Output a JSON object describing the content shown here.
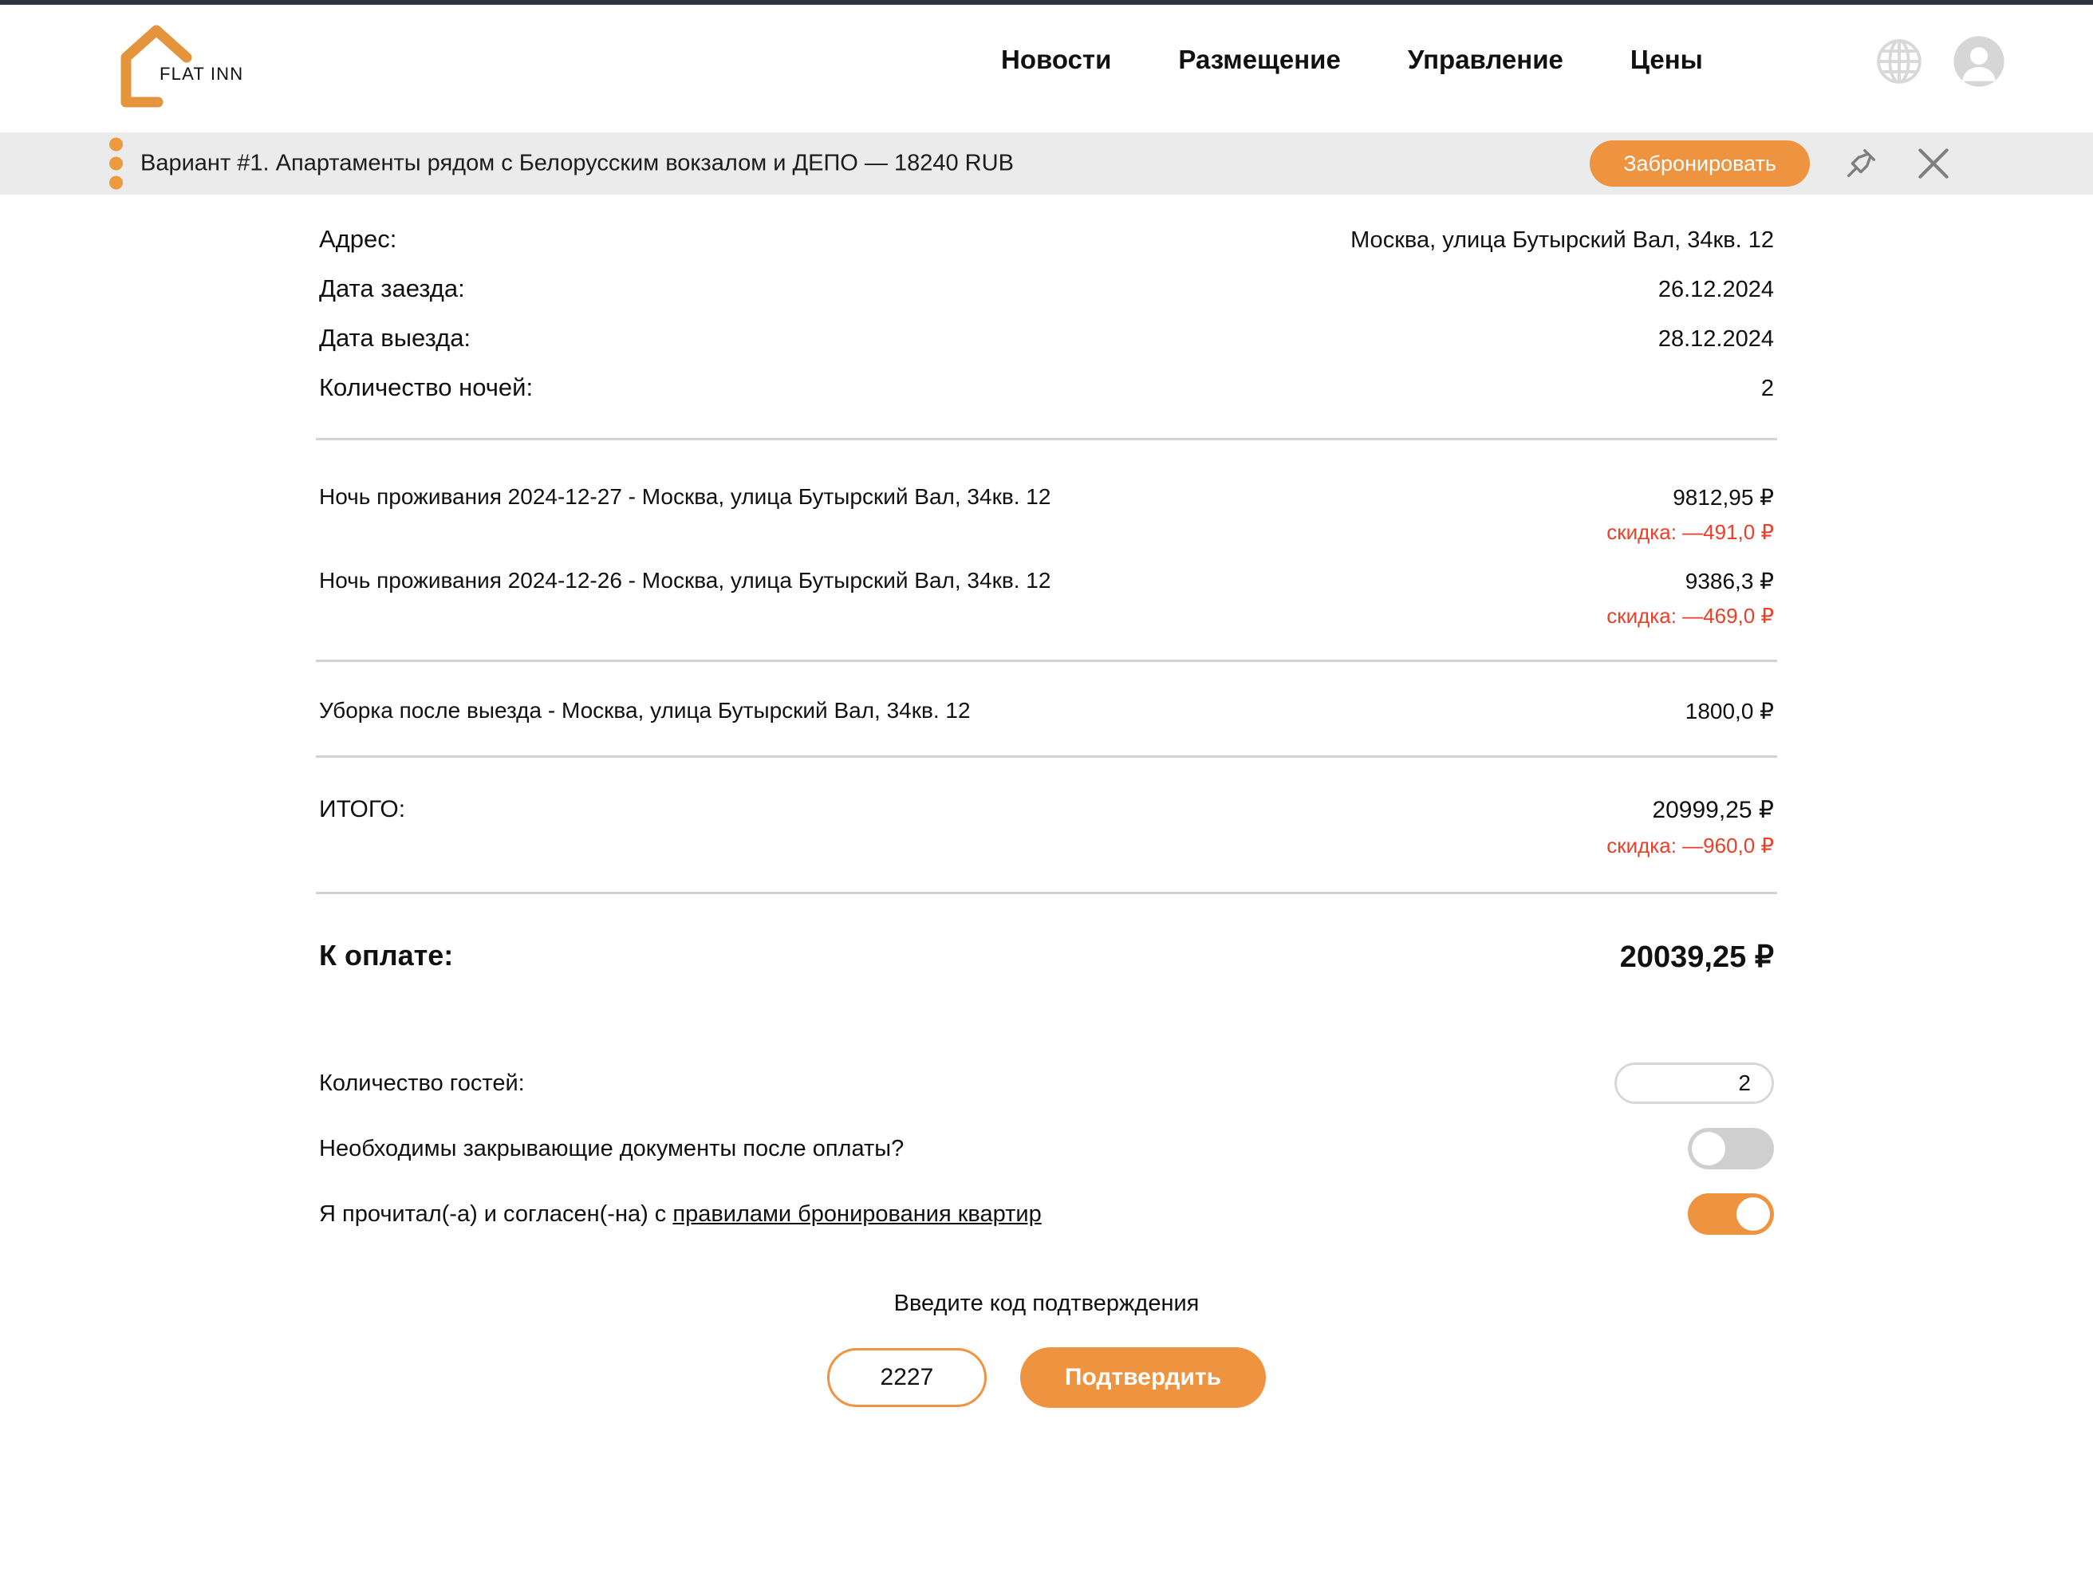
{
  "header": {
    "logo_text": "FLAT INN",
    "nav": [
      {
        "label": "Новости"
      },
      {
        "label": "Размещение"
      },
      {
        "label": "Управление"
      },
      {
        "label": "Цены"
      }
    ],
    "globe_icon": "globe-icon",
    "avatar_icon": "avatar-icon"
  },
  "banner": {
    "text": "Вариант #1. Апартаменты рядом с Белорусским вокзалом и ДЕПО — 18240 RUB",
    "book_button": "Забронировать",
    "pin_icon": "pin-icon",
    "close_icon": "close-icon"
  },
  "details": {
    "address_label": "Адрес:",
    "address_value": "Москва, улица Бутырский Вал, 34кв. 12",
    "checkin_label": "Дата заезда:",
    "checkin_value": "26.12.2024",
    "checkout_label": "Дата выезда:",
    "checkout_value": "28.12.2024",
    "nights_label": "Количество ночей:",
    "nights_value": "2"
  },
  "line_items": [
    {
      "description": "Ночь проживания 2024-12-27 - Москва, улица Бутырский Вал, 34кв. 12",
      "price": "9812,95 ₽",
      "discount": "скидка: —491,0 ₽"
    },
    {
      "description": "Ночь проживания 2024-12-26 - Москва, улица Бутырский Вал, 34кв. 12",
      "price": "9386,3 ₽",
      "discount": "скидка: —469,0 ₽"
    }
  ],
  "service_item": {
    "description": "Уборка после выезда - Москва, улица Бутырский Вал, 34кв. 12",
    "price": "1800,0 ₽"
  },
  "totals": {
    "total_label": "ИТОГО:",
    "total_price": "20999,25 ₽",
    "total_discount": "скидка: —960,0 ₽",
    "pay_label": "К оплате:",
    "pay_price": "20039,25 ₽"
  },
  "form": {
    "guests_label": "Количество гостей:",
    "guests_value": "2",
    "documents_label": "Необходимы закрывающие документы после оплаты?",
    "documents_toggle": "off",
    "agreement_prefix": "Я прочитал(-а) и согласен(-на) с ",
    "agreement_link": "правилами бронирования квартир",
    "agreement_toggle": "on"
  },
  "confirm": {
    "title": "Введите код подтверждения",
    "code_value": "2227",
    "button_label": "Подтвердить"
  },
  "colors": {
    "accent": "#ee9340",
    "discount_red": "#ec3f28",
    "banner_bg": "#ebebeb",
    "divider": "#d3d3d3",
    "toggle_off": "#cfcfcf",
    "top_strip": "#2c3640"
  }
}
